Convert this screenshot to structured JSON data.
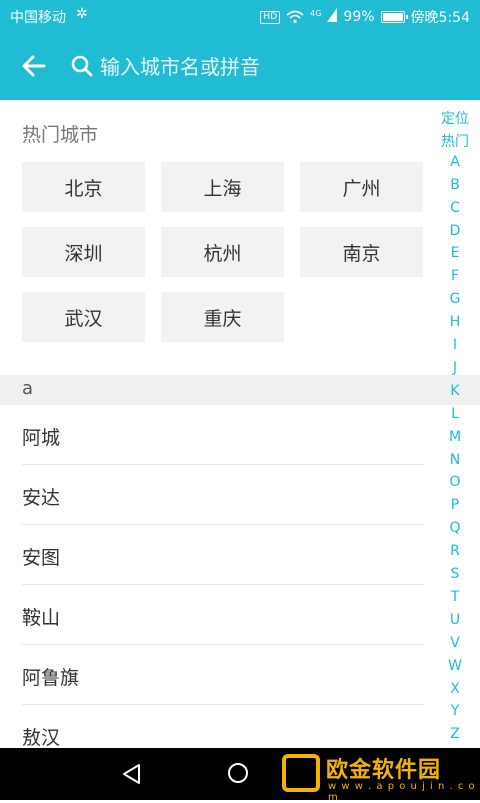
{
  "status_bar": {
    "carrier": "中国移动",
    "hd": "HD",
    "network": "4G",
    "battery": "99%",
    "time": "傍晚5:54"
  },
  "search": {
    "placeholder": "输入城市名或拼音"
  },
  "hot_cities": {
    "title": "热门城市",
    "items": [
      "北京",
      "上海",
      "广州",
      "深圳",
      "杭州",
      "南京",
      "武汉",
      "重庆"
    ]
  },
  "section": {
    "letter": "a",
    "items": [
      "阿城",
      "安达",
      "安图",
      "鞍山",
      "阿鲁旗",
      "敖汉"
    ]
  },
  "index_bar": [
    "定位",
    "热门",
    "A",
    "B",
    "C",
    "D",
    "E",
    "F",
    "G",
    "H",
    "I",
    "J",
    "K",
    "L",
    "M",
    "N",
    "O",
    "P",
    "Q",
    "R",
    "S",
    "T",
    "U",
    "V",
    "W",
    "X",
    "Y",
    "Z"
  ],
  "watermark": {
    "name": "欧金软件园",
    "url": "w w w . a p o u j i n . c o m"
  },
  "colors": {
    "accent": "#1fbcd3",
    "watermark": "#f2b400"
  }
}
